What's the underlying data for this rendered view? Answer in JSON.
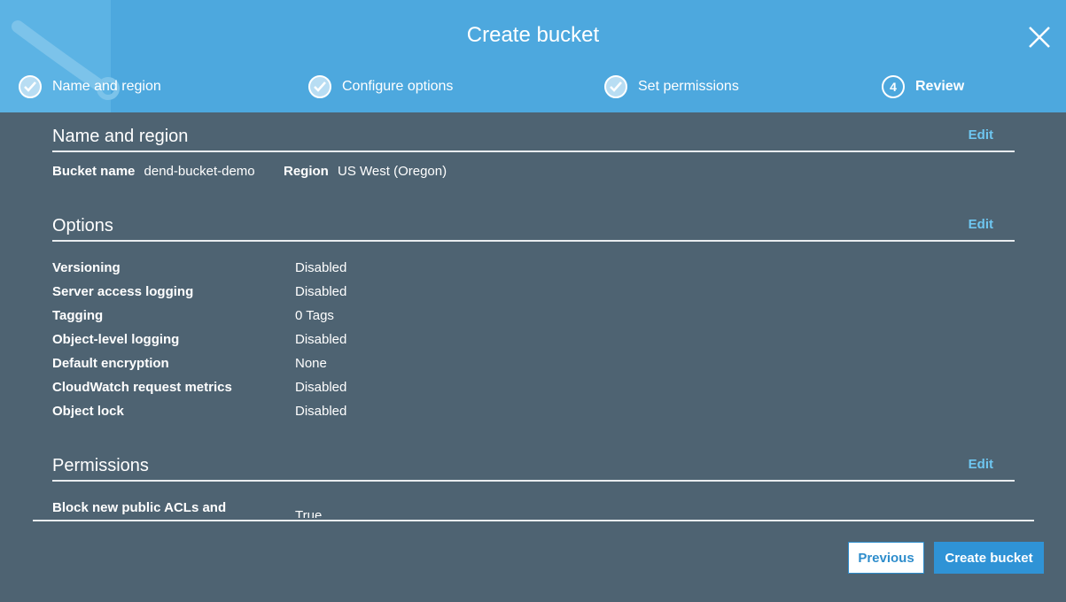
{
  "dialog": {
    "title": "Create bucket",
    "steps": [
      {
        "label": "Name and region",
        "state": "complete",
        "icon": "check-icon"
      },
      {
        "label": "Configure options",
        "state": "complete",
        "icon": "check-icon"
      },
      {
        "label": "Set permissions",
        "state": "complete",
        "icon": "check-icon"
      },
      {
        "number": "4",
        "label": "Review",
        "state": "active"
      }
    ]
  },
  "name_region": {
    "title": "Name and region",
    "edit_label": "Edit",
    "bucket_name_label": "Bucket name",
    "bucket_name_value": "dend-bucket-demo",
    "region_label": "Region",
    "region_value": "US West (Oregon)"
  },
  "options": {
    "title": "Options",
    "edit_label": "Edit",
    "rows": [
      {
        "label": "Versioning",
        "value": "Disabled"
      },
      {
        "label": "Server access logging",
        "value": "Disabled"
      },
      {
        "label": "Tagging",
        "value": "0 Tags"
      },
      {
        "label": "Object-level logging",
        "value": "Disabled"
      },
      {
        "label": "Default encryption",
        "value": "None"
      },
      {
        "label": "CloudWatch request metrics",
        "value": "Disabled"
      },
      {
        "label": "Object lock",
        "value": "Disabled"
      }
    ]
  },
  "permissions": {
    "title": "Permissions",
    "edit_label": "Edit",
    "rows": [
      {
        "label": "Block new public ACLs and",
        "value": "True"
      }
    ]
  },
  "footer": {
    "previous_label": "Previous",
    "create_label": "Create bucket"
  },
  "colors": {
    "header_bg": "#4da8de",
    "body_bg": "#4e6372",
    "link": "#6ec6f0",
    "primary_button": "#2f93d6"
  }
}
